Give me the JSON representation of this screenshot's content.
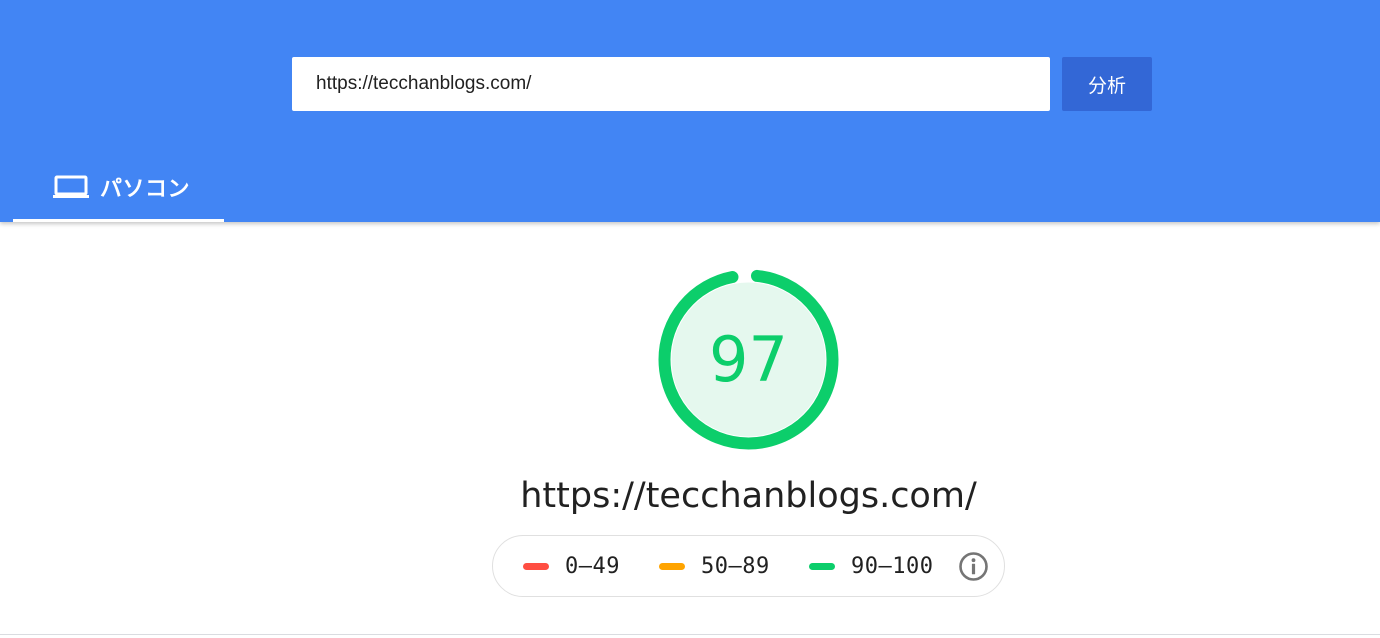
{
  "search": {
    "url_value": "https://tecchanblogs.com/",
    "analyze_label": "分析"
  },
  "tabs": [
    {
      "label": "パソコン",
      "icon": "laptop-icon",
      "active": true
    }
  ],
  "report": {
    "score": "97",
    "score_fraction": 0.97,
    "final_url": "https://tecchanblogs.com/"
  },
  "legend": {
    "items": [
      {
        "label": "0–49",
        "color": "#ff4e42"
      },
      {
        "label": "50–89",
        "color": "#ffa400"
      },
      {
        "label": "90–100",
        "color": "#0cce6b"
      }
    ],
    "info_icon": "info-icon"
  },
  "colors": {
    "header_bg": "#4285f4",
    "button_bg": "#3367d6",
    "pass_green": "#0cce6b",
    "pass_fill": "#e5f8ee"
  }
}
